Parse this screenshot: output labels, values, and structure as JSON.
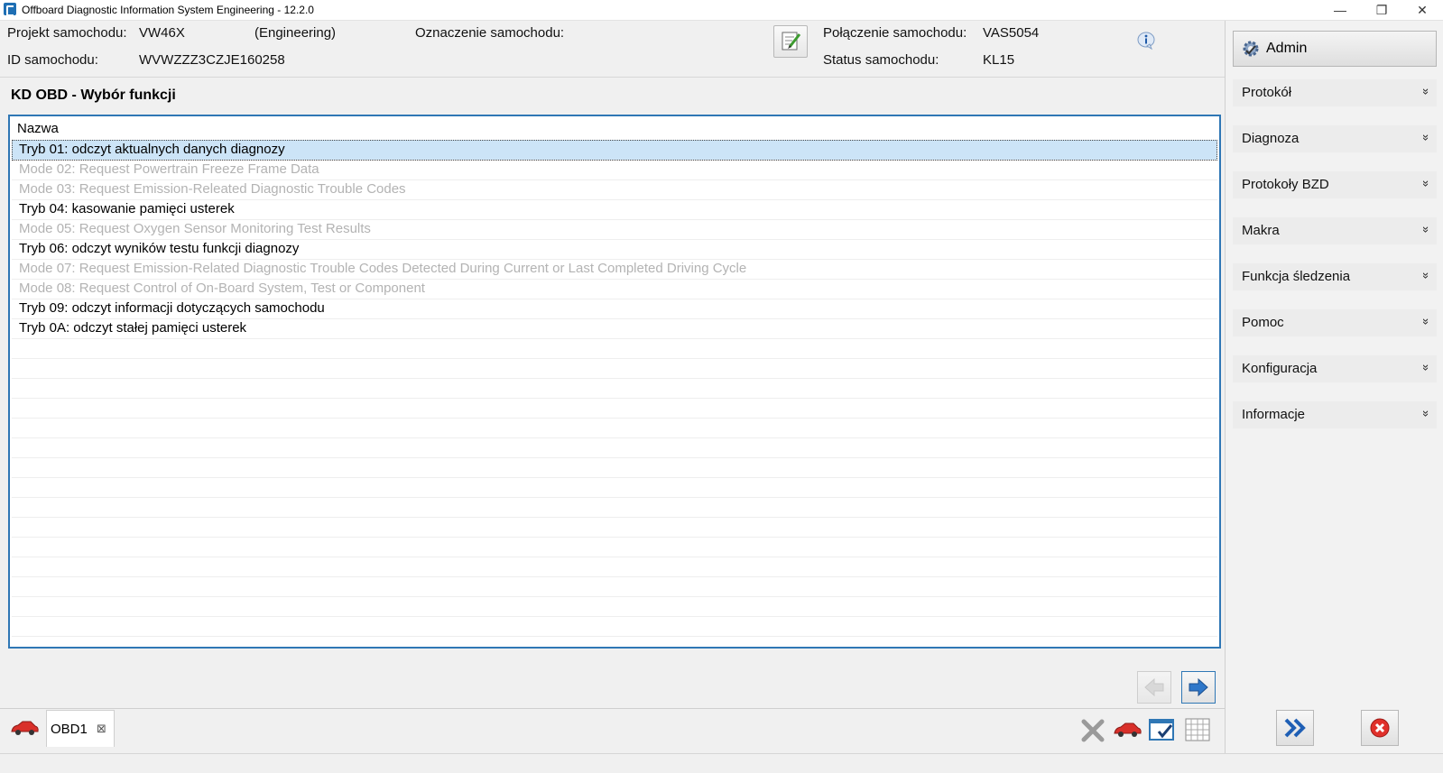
{
  "window": {
    "title": "Offboard Diagnostic Information System Engineering - 12.2.0",
    "min_glyph": "—",
    "max_glyph": "❐",
    "close_glyph": "✕"
  },
  "header": {
    "project_label": "Projekt samochodu:",
    "project_value": "VW46X",
    "project_mode": "(Engineering)",
    "designation_label": "Oznaczenie samochodu:",
    "id_label": "ID samochodu:",
    "id_value": "WVWZZZ3CZJE160258",
    "connection_label": "Połączenie samochodu:",
    "connection_value": "VAS5054",
    "status_label": "Status samochodu:",
    "status_value": "KL15"
  },
  "admin": {
    "label": "Admin"
  },
  "menu": {
    "chevron": "»",
    "items": [
      {
        "label": "Protokół"
      },
      {
        "label": "Diagnoza"
      },
      {
        "label": "Protokoły BZD"
      },
      {
        "label": "Makra"
      },
      {
        "label": "Funkcja śledzenia"
      },
      {
        "label": "Pomoc"
      },
      {
        "label": "Konfiguracja"
      },
      {
        "label": "Informacje"
      }
    ]
  },
  "main": {
    "section_title": "KD OBD - Wybór funkcji",
    "column_header": "Nazwa",
    "rows": [
      {
        "text": "Tryb 01: odczyt aktualnych danych diagnozy",
        "state": "selected"
      },
      {
        "text": "Mode 02: Request Powertrain Freeze Frame Data",
        "state": "disabled"
      },
      {
        "text": "Mode 03: Request Emission-Releated Diagnostic Trouble Codes",
        "state": "disabled"
      },
      {
        "text": "Tryb 04: kasowanie pamięci usterek",
        "state": "enabled"
      },
      {
        "text": "Mode 05: Request Oxygen Sensor Monitoring Test Results",
        "state": "disabled"
      },
      {
        "text": "Tryb 06: odczyt wyników testu funkcji diagnozy",
        "state": "enabled"
      },
      {
        "text": "Mode 07: Request Emission-Related Diagnostic Trouble Codes Detected During Current or Last Completed Driving Cycle",
        "state": "disabled"
      },
      {
        "text": "Mode 08: Request Control of On-Board System, Test or Component",
        "state": "disabled"
      },
      {
        "text": "Tryb 09: odczyt informacji dotyczących samochodu",
        "state": "enabled"
      },
      {
        "text": "Tryb 0A: odczyt stałej pamięci usterek",
        "state": "enabled"
      }
    ]
  },
  "tabs": [
    {
      "label": "OBD1",
      "close_glyph": "⊠"
    }
  ],
  "colors": {
    "accent": "#2f77b5",
    "selected_row": "#cce4f7",
    "disabled_text": "#b3b3b3",
    "close_red": "#e0312b"
  }
}
